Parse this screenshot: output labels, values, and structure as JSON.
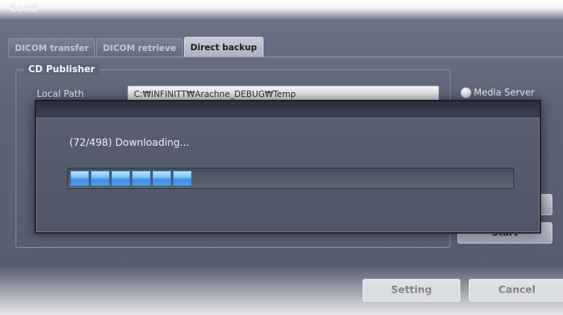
{
  "window": {
    "title": "Send"
  },
  "tabs": [
    {
      "label": "DICOM transfer",
      "active": false
    },
    {
      "label": "DICOM retrieve",
      "active": false
    },
    {
      "label": "Direct backup",
      "active": true
    }
  ],
  "cd_publisher": {
    "legend": "CD Publisher",
    "local_path_label": "Local Path",
    "local_path_value": "C:₩INFINITT₩Arachne_DEBUG₩Temp",
    "media_server_label": "Media Server"
  },
  "side_buttons": {
    "second_label": "Start"
  },
  "buttons": {
    "setting": "Setting",
    "cancel": "Cancel"
  },
  "progress": {
    "text": "(72/498) Downloading...",
    "current": 72,
    "total": 498,
    "segments_filled": 6,
    "color": "#5aa8ee"
  }
}
